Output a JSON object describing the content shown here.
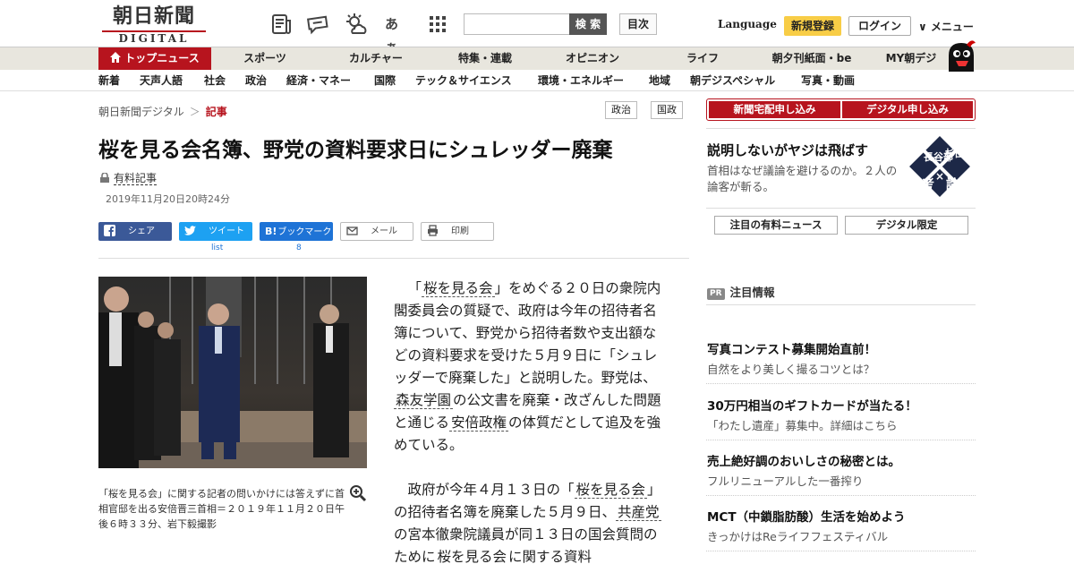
{
  "header": {
    "logo_kanji": "朝日新聞",
    "logo_sub": "DIGITAL",
    "icons": [
      "newspaper-icon",
      "chat-bubble-icon",
      "weather-icon",
      "font-size-icon",
      "apps-grid-icon"
    ],
    "font_icon_text": "あぁ",
    "search_placeholder": "",
    "search_button": "検 索",
    "toc_button": "目次",
    "language": "Language",
    "register": "新規登録",
    "login": "ログイン",
    "menu": "∨ メニュー"
  },
  "nav_primary": [
    "トップニュース",
    "スポーツ",
    "カルチャー",
    "特集・連載",
    "オピニオン",
    "ライフ",
    "朝夕刊紙面・be",
    "MY朝デジ"
  ],
  "nav_secondary": [
    "新着",
    "天声人語",
    "社会",
    "政治",
    "経済・マネー",
    "国際",
    "テック＆サイエンス",
    "環境・エネルギー",
    "地域",
    "朝デジスペシャル",
    "写真・動画"
  ],
  "breadcrumb": {
    "home": "朝日新聞デジタル",
    "separator": "＞",
    "current": "記事"
  },
  "tags": [
    "政治",
    "国政"
  ],
  "article": {
    "title": "桜を見る会名簿、野党の資料要求日にシュレッダー廃棄",
    "paid_label": "有料記事",
    "date": "2019年11月20日20時24分",
    "share": {
      "facebook": "シェア",
      "twitter": "ツイート",
      "hatena": "ブックマーク",
      "mail": "メール",
      "print": "印刷",
      "twitter_count": "list",
      "hatena_count": "8"
    },
    "caption": "「桜を見る会」に関する記者の問いかけには答えずに首相官邸を出る安倍晋三首相＝２０１９年１１月２０日午後６時３３分、岩下毅撮影",
    "p1": {
      "t1": "「",
      "k1": "桜を見る会",
      "t2": "」をめぐる２０日の衆院内閣委員会の質疑で、政府は今年の招待者名簿について、野党から招待者数や支出額などの資料要求を受けた５月９日に「シュレッダーで廃棄した」と説明した。野党は、",
      "k2": "森友学園",
      "t3": "の公文書を廃棄・改ざんした問題と通じる",
      "k3": "安倍政権",
      "t4": "の体質だとして追及を強めている。"
    },
    "p2": {
      "t1": "政府が今年４月１３日の「",
      "k1": "桜を見る会",
      "t2": "」の招待者名簿を廃棄した５月９日、",
      "k2": "共産党",
      "t3": "の宮本徹衆院議員が同１３日の国会質問のために",
      "k3": "桜を見る会",
      "t4": "に関する資料"
    }
  },
  "sidebar": {
    "subscribe_paper": "新聞宅配申し込み",
    "subscribe_digital": "デジタル申し込み",
    "promo_title": "説明しないがヤジは飛ばす",
    "promo_desc": "首相はなぜ議論を避けるのか。２人の論客が斬る。",
    "promo_logo": {
      "top_left": "長谷部",
      "top_right": "杉田",
      "bottom_left": "考",
      "mid": "×",
      "bottom_right": "論"
    },
    "btn_paid_news": "注目の有料ニュース",
    "btn_digital_only": "デジタル限定",
    "featured_pr": "PR",
    "featured_header": "注目情報",
    "featured": [
      {
        "title": "写真コンテスト募集開始直前！",
        "desc": "自然をより美しく撮るコツとは？"
      },
      {
        "title": "30万円相当のギフトカードが当たる！",
        "desc": "「わたし遺産」募集中。詳細はこちら"
      },
      {
        "title": "売上絶好調のおいしさの秘密とは。",
        "desc": "フルリニューアルした一番搾り"
      },
      {
        "title": "MCT（中鎖脂肪酸）生活を始めよう",
        "desc": "きっかけはReライフフェスティバル"
      }
    ]
  },
  "colors": {
    "brand_red": "#b7141e",
    "register_yellow": "#f8cd46",
    "nav_bg": "#e8e6de"
  }
}
